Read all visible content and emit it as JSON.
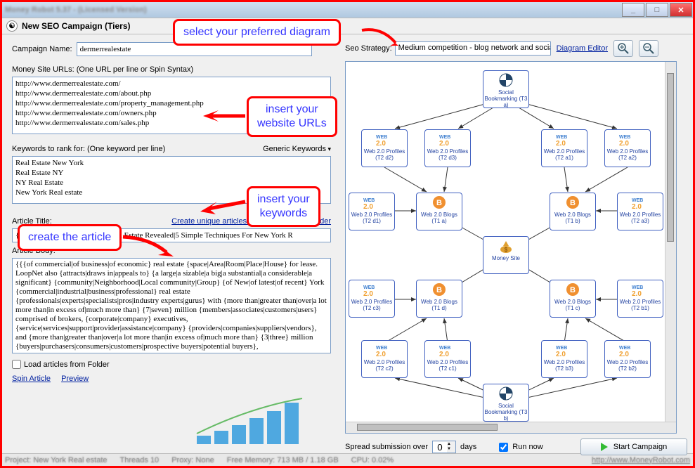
{
  "window": {
    "title": "Money Robot 5.37 - (Licensed Version)",
    "subtitle": "New SEO Campaign (Tiers)"
  },
  "left": {
    "campaign_label": "Campaign Name:",
    "campaign_value": "dermerrealestate",
    "urls_label": "Money Site URLs: (One URL per line or Spin Syntax)",
    "urls_value": "http://www.dermerrealestate.com/\nhttp://www.dermerrealestate.com/about.php\nhttp://www.dermerrealestate.com/property_management.php\nhttp://www.dermerrealestate.com/owners.php\nhttp://www.dermerrealestate.com/sales.php",
    "kw_label": "Keywords to rank for: (One keyword per line)",
    "generic_kw": "Generic Keywords",
    "kw_value": "Real Estate New York\nReal Estate NY\nNY Real Estate\nNew York Real estate",
    "art_title_label": "Article Title:",
    "art_link": "Create unique articles using MR Article Builder",
    "art_title_value": "{The Basic Principles Of NY Real Estate Revealed|5 Simple Techniques For New York R",
    "art_body_label": "Article Body:",
    "art_body_value": "{{{of commercial|of business|of economic} real estate {space|Area|Room|Place|House} for lease. LoopNet also {attracts|draws in|appeals to} {a large|a sizable|a big|a substantial|a considerable|a significant} {community|Neighborhood|Local community|Group} {of New|of latest|of recent} York {commercial|industrial|business|professional} real estate {professionals|experts|specialists|pros|industry experts|gurus} with {more than|greater than|over|a lot more than|in excess of|much more than} {7|seven} million {members|associates|customers|users} comprised of brokers, {corporate|company} executives, {service|services|support|provider|assistance|company} {providers|companies|suppliers|vendors}, and {more than|greater than|over|a lot more than|in excess of|much more than} {3|three} million {buyers|purchasers|consumers|customers|prospective buyers|potential buyers},",
    "load_label": "Load articles from Folder",
    "spin_link": "Spin Article",
    "preview_link": "Preview"
  },
  "right": {
    "seo_label": "Seo Strategy:",
    "seo_value": "Medium competition - blog network and social bo",
    "de_link": "Diagram Editor",
    "spread_label": "Spread submission over",
    "spread_value": "0",
    "days": "days",
    "run_now": "Run now",
    "start": "Start Campaign"
  },
  "nodes": {
    "sb_top": "Social\nBookmarking\n(T3 a)",
    "sb_bot": "Social\nBookmarking\n(T3 b)",
    "money": "Money Site",
    "w20_r1c1": "Web 2.0\nProfiles (T2 d2)",
    "w20_r1c2": "Web 2.0\nProfiles (T2 d3)",
    "w20_r1c3": "Web 2.0\nProfiles (T2 a1)",
    "w20_r1c4": "Web 2.0\nProfiles (T2 a2)",
    "w20_r2c1": "Web 2.0\nProfiles (T2 d1)",
    "w20_r2c4": "Web 2.0\nProfiles (T2 a3)",
    "w20_r3c1": "Web 2.0\nProfiles (T2 c3)",
    "w20_r3c4": "Web 2.0\nProfiles (T2 b1)",
    "w20_r4c1": "Web 2.0\nProfiles (T2 c2)",
    "w20_r4c2": "Web 2.0\nProfiles (T2 c1)",
    "w20_r4c3": "Web 2.0\nProfiles (T2 b3)",
    "w20_r4c4": "Web 2.0\nProfiles (T2 b2)",
    "blog_tl": "Web 2.0 Blogs\n(T1 a)",
    "blog_tr": "Web 2.0 Blogs\n(T1 b)",
    "blog_bl": "Web 2.0 Blogs\n(T1 d)",
    "blog_br": "Web 2.0 Blogs\n(T1 c)"
  },
  "ann": {
    "diagram": "select your preferred diagram",
    "urls": "insert your\nwebsite URLs",
    "kw": "insert your\nkeywords",
    "article": "create the article"
  },
  "status": {
    "project": "Project: New York Real estate",
    "threads": "Threads 10",
    "proxy": "Proxy: None",
    "mem": "Free Memory: 713 MB / 1.18 GB",
    "cpu": "CPU: 0.02%",
    "link": "http://www.MoneyRobot.com"
  }
}
